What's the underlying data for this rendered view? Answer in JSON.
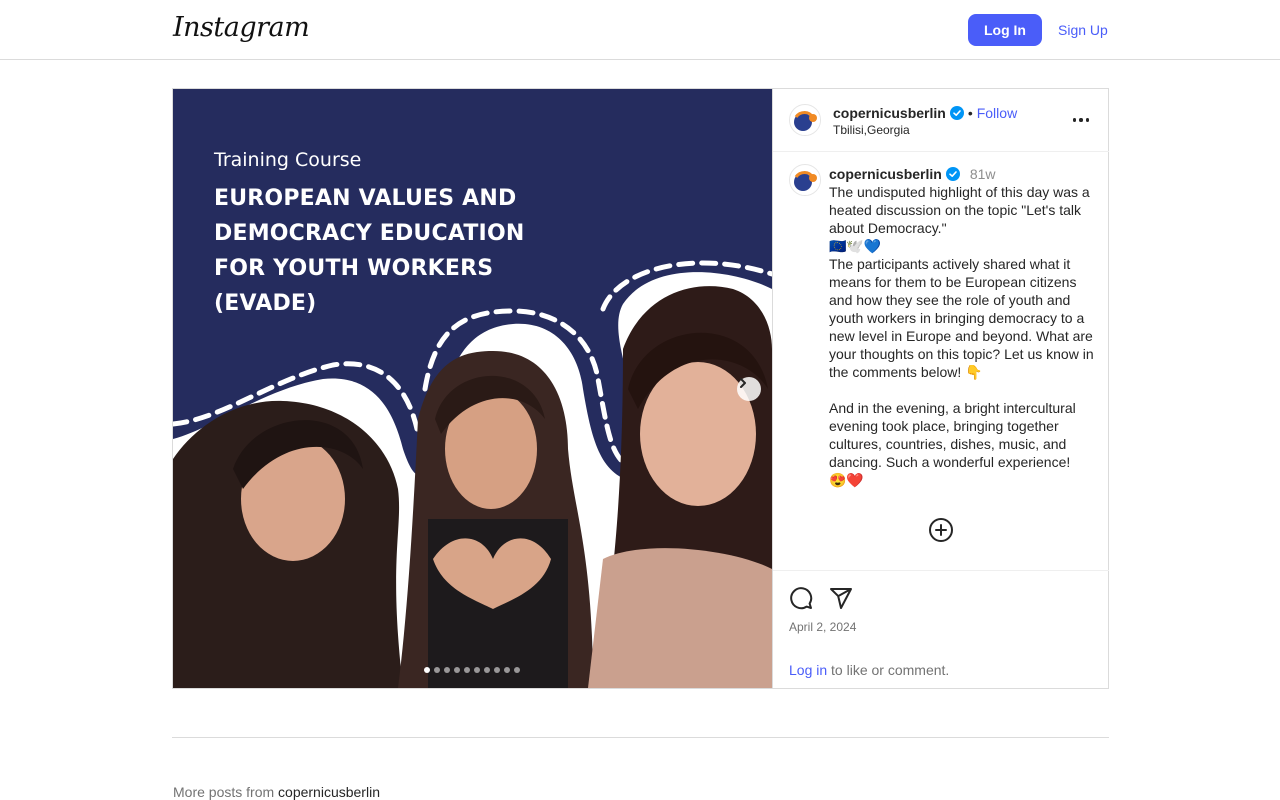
{
  "header": {
    "logo_text": "Instagram",
    "login_label": "Log In",
    "signup_label": "Sign Up"
  },
  "post": {
    "media": {
      "slide_title": "Training Course",
      "slide_headline": "EUROPEAN VALUES AND DEMOCRACY EDUCATION FOR YOUTH WORKERS (EVADE)",
      "slide_count": 10,
      "active_slide": 1
    },
    "author": {
      "username": "copernicusberlin",
      "verified": true,
      "follow_label": "Follow",
      "separator": "•",
      "location": "Tbilisi,Georgia"
    },
    "caption": {
      "username": "copernicusberlin",
      "time_ago": "81w",
      "paragraphs": [
        "The undisputed highlight of this day was a heated discussion on the topic \"Let's talk about Democracy.\"",
        "🇪🇺🕊️💙",
        "The participants actively shared what it means for them to be European citizens and how they see the role of youth and youth workers in bringing democracy to a new level in Europe and beyond. What are your thoughts on this topic? Let us know in the comments below! 👇",
        "",
        "And in the evening, a bright intercultural evening took place, bringing together cultures, countries, dishes, music, and dancing. Such a wonderful experience!",
        "😍❤️"
      ]
    },
    "date": "April 2, 2024",
    "login_prompt": {
      "link": "Log in",
      "rest": " to like or comment."
    }
  },
  "more_posts": {
    "prefix": "More posts from ",
    "username": "copernicusberlin"
  },
  "colors": {
    "accent": "#4a5df9",
    "slide_bg": "#252c5e",
    "verified": "#0095f6"
  },
  "icons": [
    "chevron-right-icon",
    "more-options-icon",
    "verified-badge-icon",
    "add-circle-icon",
    "comment-icon",
    "share-icon"
  ]
}
